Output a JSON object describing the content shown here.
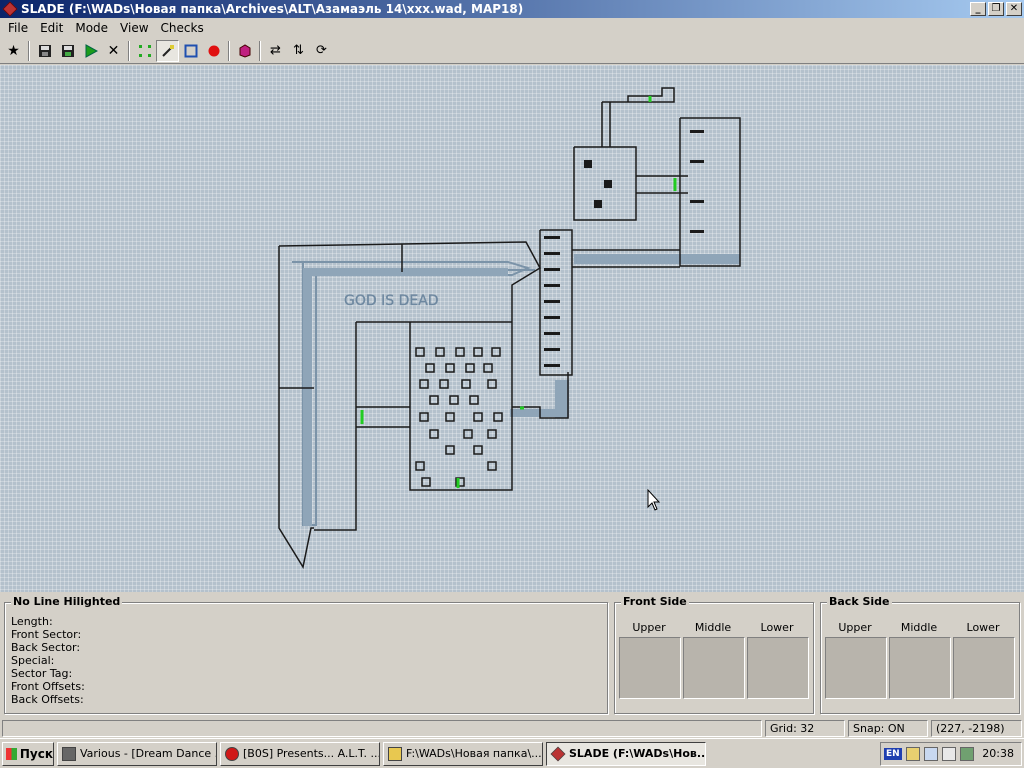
{
  "window": {
    "title": "SLADE (F:\\WADs\\Новая папка\\Archives\\ALT\\Азамаэль 14\\xxx.wad, MAP18)",
    "buttons": [
      "_",
      "❐",
      "✕"
    ]
  },
  "menu": [
    "File",
    "Edit",
    "Mode",
    "View",
    "Checks"
  ],
  "toolbar": {
    "icons": [
      "favorite-icon",
      "save-icon",
      "save-all-icon",
      "run-icon",
      "close-icon",
      "vertices-mode-icon",
      "lines-mode-icon",
      "sectors-mode-icon",
      "things-mode-icon",
      "3d-mode-icon",
      "flip-icon",
      "mirror-icon",
      "rotate-icon"
    ]
  },
  "map": {
    "label": "GOD IS DEAD",
    "colors": {
      "background": "#b4c1cc",
      "wall": "#1a1a1a",
      "two_sided": "#6e88a0",
      "special": "#22cc22"
    }
  },
  "info": {
    "line_panel": {
      "title": "No Line Hilighted",
      "fields": [
        "Length:",
        "Front Sector:",
        "Back Sector:",
        "Special:",
        "Sector Tag:",
        "Front Offsets:",
        "Back Offsets:"
      ]
    },
    "front_side": {
      "title": "Front Side",
      "labels": [
        "Upper",
        "Middle",
        "Lower"
      ]
    },
    "back_side": {
      "title": "Back Side",
      "labels": [
        "Upper",
        "Middle",
        "Lower"
      ]
    }
  },
  "status": {
    "grid": "Grid: 32",
    "snap": "Snap: ON",
    "coords": "(227, -2198)"
  },
  "taskbar": {
    "start": "Пуск",
    "tasks": [
      "Various - [Dream Dance ...",
      "[B0S] Presents... A.L.T. ...",
      "F:\\WADs\\Новая папка\\...",
      "SLADE (F:\\WADs\\Нов..."
    ],
    "tray_lang": "EN",
    "clock": "20:38"
  }
}
